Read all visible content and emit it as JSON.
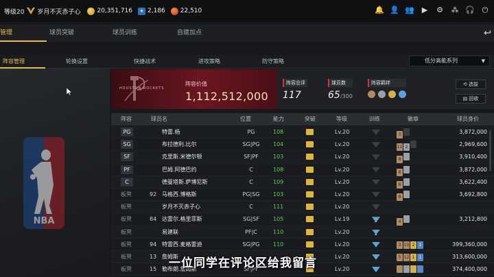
{
  "topbar": {
    "level": "等级20",
    "username": "岁月不灭赤子心",
    "gold": "20,351,716",
    "points": "2,186",
    "coins": "22,510"
  },
  "tabs": [
    {
      "label": "管理",
      "active": true
    },
    {
      "label": "球员突破",
      "active": false
    },
    {
      "label": "球员训练",
      "active": false
    },
    {
      "label": "自建加点",
      "active": false
    }
  ],
  "subtabs": [
    {
      "label": "阵容管理",
      "active": true
    },
    {
      "label": "轮换设置",
      "active": false
    },
    {
      "label": "快捷战术",
      "active": false
    },
    {
      "label": "进攻策略",
      "active": false
    },
    {
      "label": "防守策略",
      "active": false
    }
  ],
  "dropdown": {
    "label": "低分高能系列"
  },
  "banner": {
    "team_logo_text": "HOUSTON ROCKETS",
    "value_label": "阵容价值",
    "value": "1,112,512,000"
  },
  "stats": {
    "rating_label": "阵容总评",
    "rating": "117",
    "count_label": "球员数",
    "count": "65",
    "count_max": "/300",
    "bond_label": "阵容羁绊"
  },
  "buttons": {
    "filter": "选拔",
    "recycle": "回收"
  },
  "table": {
    "headers": [
      "阵容",
      "球员名",
      "位置",
      "能力",
      "突破",
      "等级",
      "训练",
      "徽章",
      "球员身价"
    ],
    "rows": [
      {
        "role": "PG",
        "bench": false,
        "num": "",
        "name": "特雷.杨",
        "pos": "PG",
        "ability": "108",
        "level": "Lv.20",
        "train": "gray",
        "badges": [
          "bronze:3",
          "darkb:"
        ],
        "salary": "3,872,000"
      },
      {
        "role": "SG",
        "bench": false,
        "num": "",
        "name": "布拉德利.比尔",
        "pos": "SG|PG",
        "ability": "104",
        "level": "Lv.20",
        "train": "gray",
        "badges": [
          "bronze:11",
          "silver:2",
          "darkb:"
        ],
        "salary": "2,969,600"
      },
      {
        "role": "SF",
        "bench": false,
        "num": "",
        "name": "克里斯.米德尔顿",
        "pos": "SF|PF",
        "ability": "103",
        "level": "Lv.20",
        "train": "gray",
        "badges": [
          "bronze:8",
          "silver:"
        ],
        "salary": "3,910,400"
      },
      {
        "role": "PF",
        "bench": false,
        "num": "",
        "name": "巴姆.阿德巴约",
        "pos": "C",
        "ability": "108",
        "level": "Lv.20",
        "train": "gray",
        "badges": [
          "bronze:6",
          "silver:"
        ],
        "salary": "3,872,000"
      },
      {
        "role": "C",
        "bench": false,
        "num": "",
        "name": "德曼塔斯.萨博尼斯",
        "pos": "C",
        "ability": "109",
        "level": "Lv.20",
        "train": "gray",
        "badges": [
          "bronze:8",
          "silver:"
        ],
        "salary": "3,622,400"
      },
      {
        "role": "板凳",
        "bench": true,
        "num": "92",
        "name": "马格西.博格斯",
        "pos": "PG|SG",
        "ability": "103",
        "level": "Lv.20",
        "train": "gray",
        "badges": [
          "bronze:8",
          "silver:"
        ],
        "salary": "3,692,800"
      },
      {
        "role": "板凳",
        "bench": true,
        "num": "",
        "name": "岁月不灭赤子心",
        "pos": "C",
        "ability": "111",
        "level": "Lv.20",
        "train": "gray",
        "badges": [],
        "salary": ""
      },
      {
        "role": "板凳",
        "bench": true,
        "num": "84",
        "name": "达雷尔.格里菲斯",
        "pos": "SG|SF",
        "ability": "105",
        "level": "Lv.19",
        "train": "blue:2",
        "badges": [
          "bronze:4",
          "silver:"
        ],
        "salary": "3,212,800"
      },
      {
        "role": "板凳",
        "bench": true,
        "num": "",
        "name": "易建联",
        "pos": "PF|C",
        "ability": "110",
        "level": "Lv.20",
        "train": "blue:2",
        "badges": [],
        "salary": ""
      },
      {
        "role": "板凳",
        "bench": true,
        "num": "94",
        "name": "特雷西.麦格雷迪",
        "pos": "SG|PG",
        "ability": "110",
        "level": "Lv.20",
        "train": "blue",
        "badges": [
          "bronze:3",
          "bronze:15",
          "gold:2",
          "blueb:1"
        ],
        "salary": "399,360,000"
      },
      {
        "role": "板凳",
        "bench": true,
        "num": "13",
        "name": "詹姆斯",
        "pos": "",
        "ability": "",
        "level": "Lv.20",
        "train": "blue",
        "badges": [
          "bronze:5",
          "bronze:12",
          "gold:1",
          "blueb:1"
        ],
        "salary": "313,600,000"
      },
      {
        "role": "板凳",
        "bench": true,
        "num": "15",
        "name": "勒布朗.詹姆斯",
        "pos": "SF|PF",
        "ability": "",
        "level": "Lv.20",
        "train": "blue",
        "badges": [
          "bronze:",
          "silver:",
          "gold:",
          "blueb:"
        ],
        "salary": "374,400,000"
      }
    ]
  },
  "subtitle": "一位同学在评论区给我留言",
  "colors": {
    "accent": "#e9b84a",
    "team_red": "#6b1620",
    "ability_green": "#5ecf4e"
  }
}
